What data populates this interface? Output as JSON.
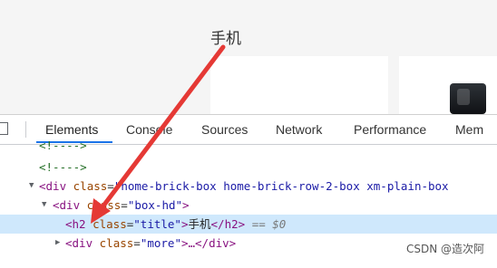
{
  "page": {
    "section_title": "手机"
  },
  "devtools": {
    "tabs": [
      {
        "label": "Elements",
        "active": true
      },
      {
        "label": "Console",
        "active": false
      },
      {
        "label": "Sources",
        "active": false
      },
      {
        "label": "Network",
        "active": false
      },
      {
        "label": "Performance",
        "active": false
      },
      {
        "label": "Mem",
        "active": false
      }
    ]
  },
  "tree": {
    "comment_1": "<!---->",
    "comment_2": "<!---->",
    "row_box": {
      "open": "<div ",
      "attr": "class",
      "eq": "=",
      "value": "\"home-brick-box home-brick-row-2-box xm-plain-box"
    },
    "box_hd": {
      "open": "<div ",
      "attr": "class",
      "eq": "=",
      "value": "\"box-hd\"",
      "close": ">"
    },
    "h2": {
      "open": "<h2 ",
      "attr": "class",
      "eq": "=",
      "value": "\"title\"",
      "close": ">",
      "text": "手机",
      "end": "</h2>",
      "marker": "== $0"
    },
    "more": {
      "open": "<div ",
      "attr": "class",
      "eq": "=",
      "value": "\"more\"",
      "close": ">…</div>"
    }
  },
  "watermark": "CSDN @造次阿",
  "colors": {
    "selected_row": "#cfe8fc",
    "tab_underline": "#1a73e8",
    "arrow": "#e53935"
  }
}
